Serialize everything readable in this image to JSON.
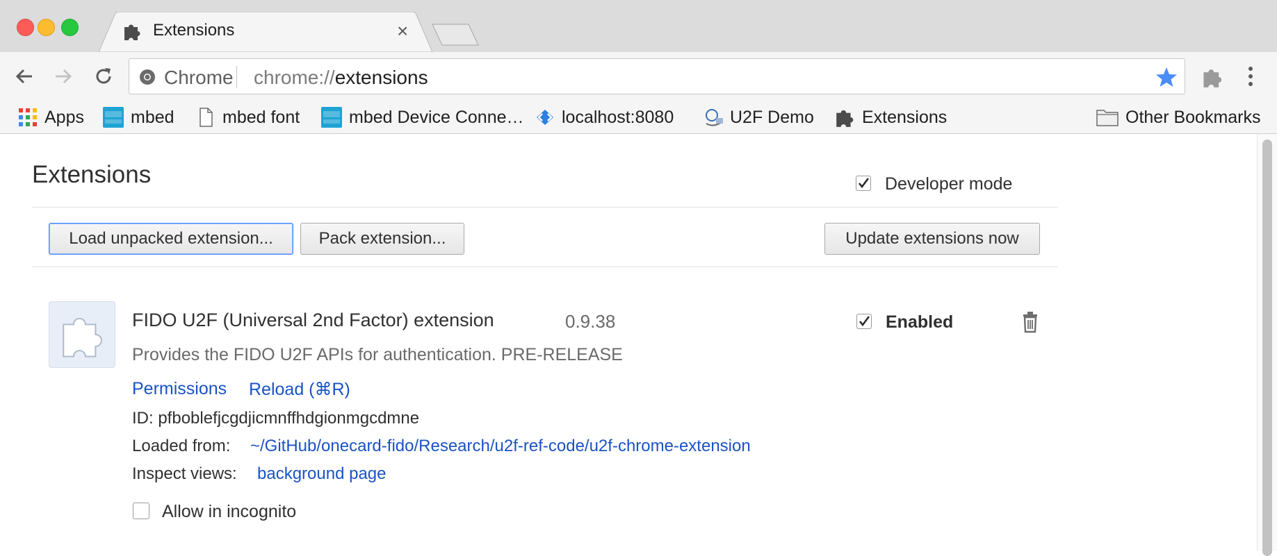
{
  "window": {
    "traffic_lights": {
      "close": "#fc5b57",
      "minimize": "#fdbb2e",
      "zoom": "#27c840"
    }
  },
  "tabs": [
    {
      "title": "Extensions",
      "icon": "puzzle-icon",
      "active": true
    },
    {
      "title": "",
      "icon": "",
      "active": false
    }
  ],
  "toolbar": {
    "omnibox_label": "Chrome",
    "url_scheme": "chrome://",
    "url_host": "extensions",
    "star_color": "#4a8df8"
  },
  "bookmarks": {
    "items": [
      {
        "label": "Apps",
        "icon": "apps-grid-icon"
      },
      {
        "label": "mbed",
        "icon": "arm-mbed-icon"
      },
      {
        "label": "mbed font",
        "icon": "page-icon"
      },
      {
        "label": "mbed Device Conne…",
        "icon": "arm-mbed-icon"
      },
      {
        "label": "localhost:8080",
        "icon": "code-diamond-icon"
      },
      {
        "label": "U2F Demo",
        "icon": "u2f-demo-icon"
      },
      {
        "label": "Extensions",
        "icon": "puzzle-icon"
      }
    ],
    "other": "Other Bookmarks"
  },
  "page": {
    "title": "Extensions",
    "developer_mode": {
      "label": "Developer mode",
      "checked": true
    },
    "buttons": {
      "load_unpacked": "Load unpacked extension...",
      "pack": "Pack extension...",
      "update": "Update extensions now"
    }
  },
  "extension": {
    "name": "FIDO U2F (Universal 2nd Factor) extension",
    "version": "0.9.38",
    "enabled_label": "Enabled",
    "enabled": true,
    "description": "Provides the FIDO U2F APIs for authentication. PRE-RELEASE",
    "permissions_link": "Permissions",
    "reload_link": "Reload (⌘R)",
    "id_text": "ID: pfboblefjcgdjicmnffhdgionmgcdmne",
    "loaded_from_label": "Loaded from:",
    "loaded_from_path": "~/GitHub/onecard-fido/Research/u2f-ref-code/u2f-chrome-extension",
    "inspect_label": "Inspect views:",
    "inspect_link": "background page",
    "incognito_label": "Allow in incognito",
    "incognito_checked": false
  }
}
